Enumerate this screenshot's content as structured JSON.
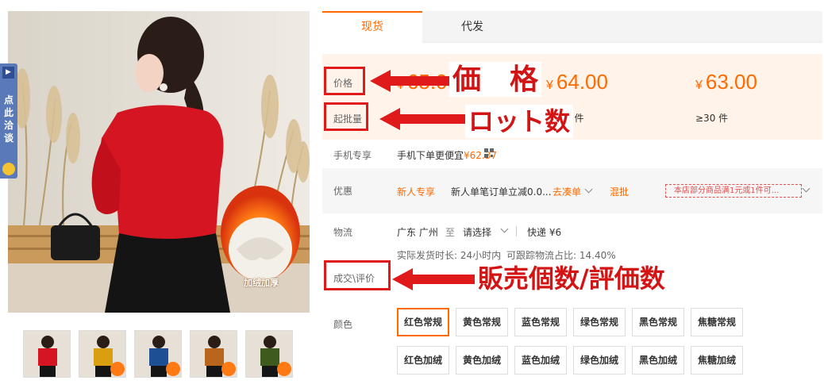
{
  "side_tab": {
    "label": "点此洽谈"
  },
  "product_image": {
    "badge_text": "加绒加厚"
  },
  "tabs": [
    {
      "label": "现货"
    },
    {
      "label": "代发"
    }
  ],
  "price_section": {
    "price_label": "价格",
    "lot_label": "起批量",
    "tiers": [
      {
        "price": "65.00",
        "min_qty": ""
      },
      {
        "price": "64.00",
        "min_qty": "9 件"
      },
      {
        "price": "63.00",
        "min_qty": "≥30 件"
      }
    ],
    "currency": "¥"
  },
  "mobile": {
    "label": "手机专享",
    "text": "手机下单更便宜",
    "price": "¥62.37"
  },
  "promo": {
    "label": "优惠",
    "new_user": "新人专享",
    "new_user_desc": "新人单笔订单立减0.0...",
    "combine": "去凑单",
    "mixed": "混批",
    "tag": "本店部分商品满1元或1件可..."
  },
  "logistics": {
    "label": "物流",
    "origin": "广东 广州",
    "to": "至",
    "select": "请选择",
    "express": "快递 ¥6",
    "ship_time": "实际发货时长: 24小时内",
    "track_ratio": "可跟踪物流占比: 14.40%"
  },
  "reviews": {
    "label": "成交\\评价"
  },
  "colors": {
    "label": "颜色",
    "options": [
      "红色常规",
      "黄色常规",
      "蓝色常规",
      "绿色常规",
      "黑色常规",
      "焦糖常规",
      "红色加绒",
      "黄色加绒",
      "蓝色加绒",
      "绿色加绒",
      "黑色加绒",
      "焦糖加绒"
    ],
    "selected_index": 0
  },
  "annotations": {
    "price": "価　格",
    "lot": "ロット数",
    "sales": "販売個数/評価数"
  },
  "theme": {
    "accent": "#ff6a00",
    "annotation_red": "#e01a1a",
    "price_bg": "#fff3ea"
  }
}
